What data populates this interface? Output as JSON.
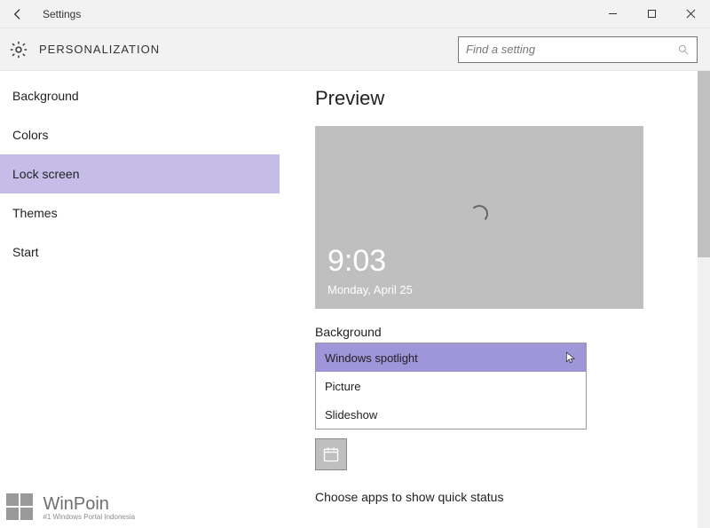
{
  "window": {
    "title": "Settings"
  },
  "header": {
    "section": "PERSONALIZATION",
    "search_placeholder": "Find a setting"
  },
  "sidebar": {
    "items": [
      {
        "label": "Background"
      },
      {
        "label": "Colors"
      },
      {
        "label": "Lock screen"
      },
      {
        "label": "Themes"
      },
      {
        "label": "Start"
      }
    ],
    "selected_index": 2
  },
  "content": {
    "preview_heading": "Preview",
    "clock": "9:03",
    "date": "Monday, April 25",
    "background_label": "Background",
    "dropdown_options": [
      "Windows spotlight",
      "Picture",
      "Slideshow"
    ],
    "dropdown_hovered_index": 0,
    "quick_status_label": "Choose apps to show quick status"
  },
  "watermark": {
    "title": "WinPoin",
    "sub": "#1 Windows Portal Indonesia"
  }
}
